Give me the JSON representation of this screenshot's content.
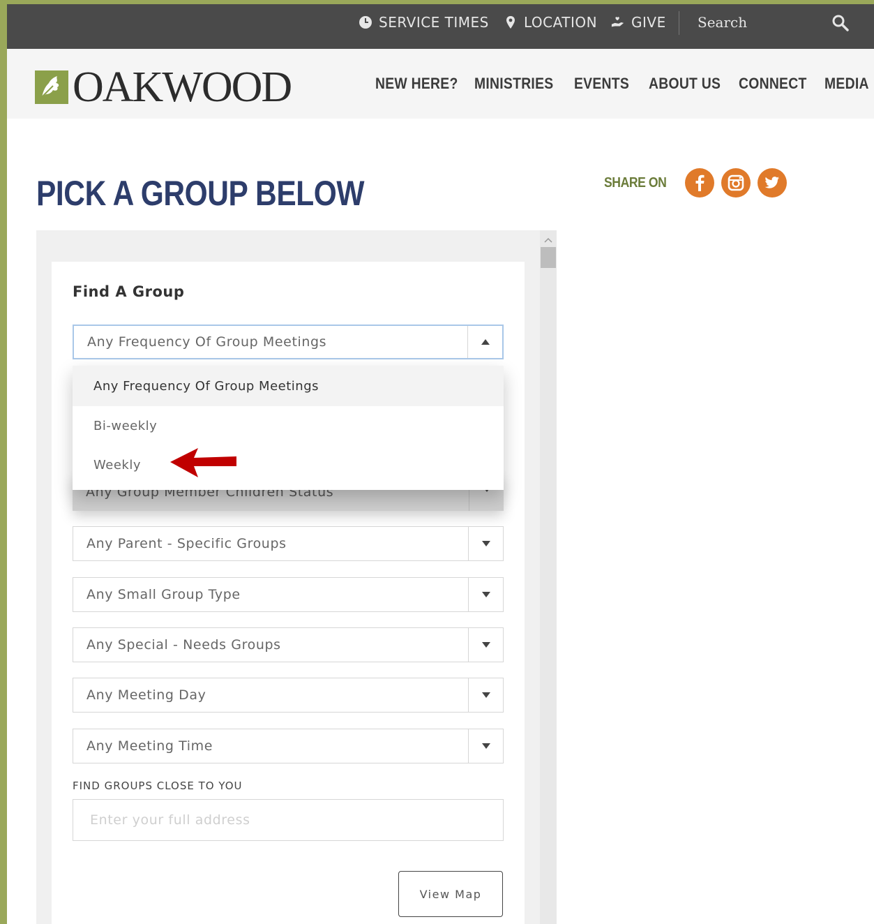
{
  "utility_bar": {
    "service_times": "SERVICE TIMES",
    "location": "LOCATION",
    "give": "GIVE",
    "search": "Search"
  },
  "header": {
    "logo_text": "OAKWOOD",
    "nav": [
      "NEW HERE?",
      "MINISTRIES",
      "EVENTS",
      "ABOUT US",
      "CONNECT",
      "MEDIA"
    ]
  },
  "page_title": "PICK A GROUP BELOW",
  "share": {
    "label": "SHARE ON",
    "networks": [
      "facebook",
      "instagram",
      "twitter"
    ]
  },
  "colors": {
    "accent_orange": "#e07a2a",
    "title_blue": "#2d3d6b",
    "olive": "#6b7c3a",
    "arrow_red": "#c00000"
  },
  "form": {
    "title": "Find A Group",
    "frequency_select": {
      "value": "Any Frequency Of Group Meetings",
      "options": [
        "Any Frequency Of Group Meetings",
        "Bi-weekly",
        "Weekly"
      ]
    },
    "children_status_select": "Any Group Member Children Status",
    "parent_groups_select": "Any Parent - Specific Groups",
    "small_group_type_select": "Any Small Group Type",
    "special_needs_select": "Any Special - Needs Groups",
    "meeting_day_select": "Any Meeting Day",
    "meeting_time_select": "Any Meeting Time",
    "close_label": "FIND GROUPS CLOSE TO YOU",
    "address_placeholder": "Enter your full address",
    "view_map": "View Map"
  }
}
